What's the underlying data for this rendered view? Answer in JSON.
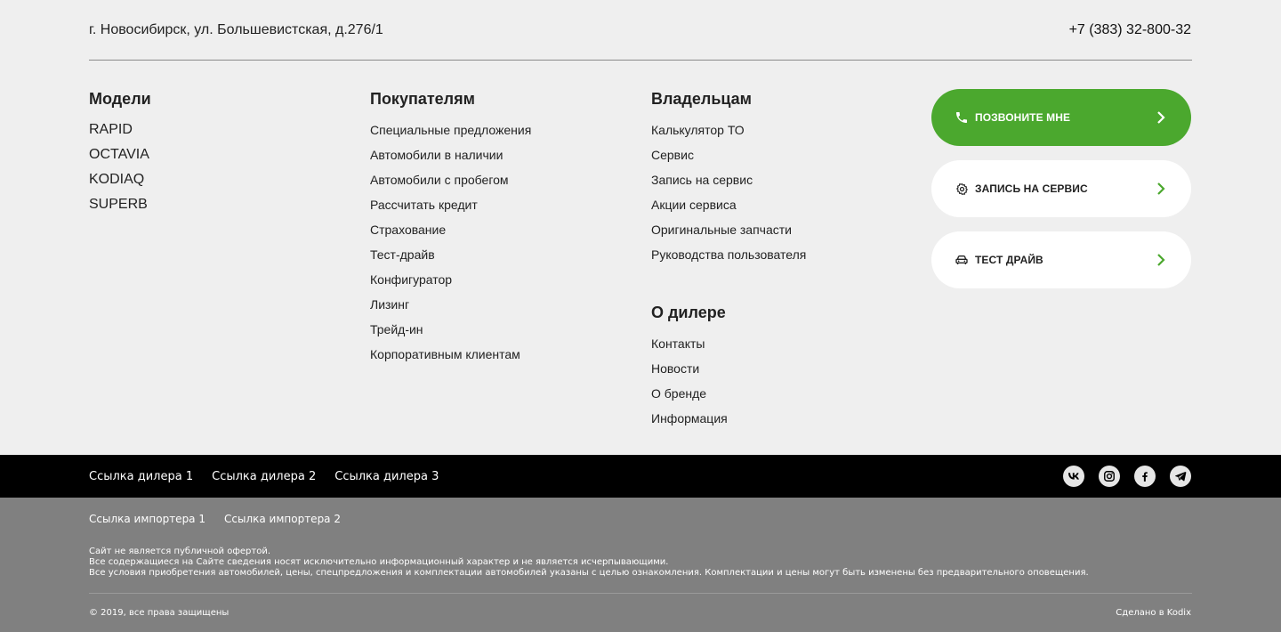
{
  "header": {
    "address": "г. Новосибирск, ул. Большевистская, д.276/1",
    "phone": "+7 (383) 32-800-32"
  },
  "models": {
    "title": "Модели",
    "items": [
      "RAPID",
      "OCTAVIA",
      "KODIAQ",
      "SUPERB"
    ]
  },
  "buyers": {
    "title": "Покупателям",
    "items": [
      "Специальные предложения",
      "Автомобили в наличии",
      "Автомобили с пробегом",
      "Рассчитать кредит",
      "Страхование",
      "Тест-драйв",
      "Конфигуратор",
      "Лизинг",
      "Трейд-ин",
      "Корпоративным клиентам"
    ]
  },
  "owners": {
    "title": "Владельцам",
    "items": [
      "Калькулятор ТО",
      "Сервис",
      "Запись на сервис",
      "Акции сервиса",
      "Оригинальные запчасти",
      "Руководства пользователя"
    ]
  },
  "dealer": {
    "title": "О дилере",
    "items": [
      "Контакты",
      "Новости",
      "О бренде",
      "Информация"
    ]
  },
  "cta": {
    "call": {
      "label": "ПОЗВОНИТЕ МНЕ",
      "icon": "phone-icon"
    },
    "service": {
      "label": "ЗАПИСЬ НА СЕРВИС",
      "icon": "gear-icon"
    },
    "drive": {
      "label": "ТЕСТ ДРАЙВ",
      "icon": "car-icon"
    },
    "accent": "#4ba82e"
  },
  "dealer_links": [
    "Ссылка дилера 1",
    "Ссылка дилера 2",
    "Ссылка дилера 3"
  ],
  "social": [
    "vk-icon",
    "instagram-icon",
    "facebook-icon",
    "telegram-icon"
  ],
  "importer_links": [
    "Ссылка импортера 1",
    "Ссылка импортера 2"
  ],
  "disclaimer": [
    "Сайт не является публичной офертой.",
    "Все содержащиеся на Сайте сведения носят исключительно информационный характер и не является исчерпывающими.",
    "Все условия приобретения автомобилей, цены, спецпредложения и комплектации автомобилей указаны с целью ознакомления. Комплектации и цены могут быть изменены без предварительного оповещения."
  ],
  "copyright": "© 2019, все права защищены",
  "made_by": "Сделано в Kodix"
}
